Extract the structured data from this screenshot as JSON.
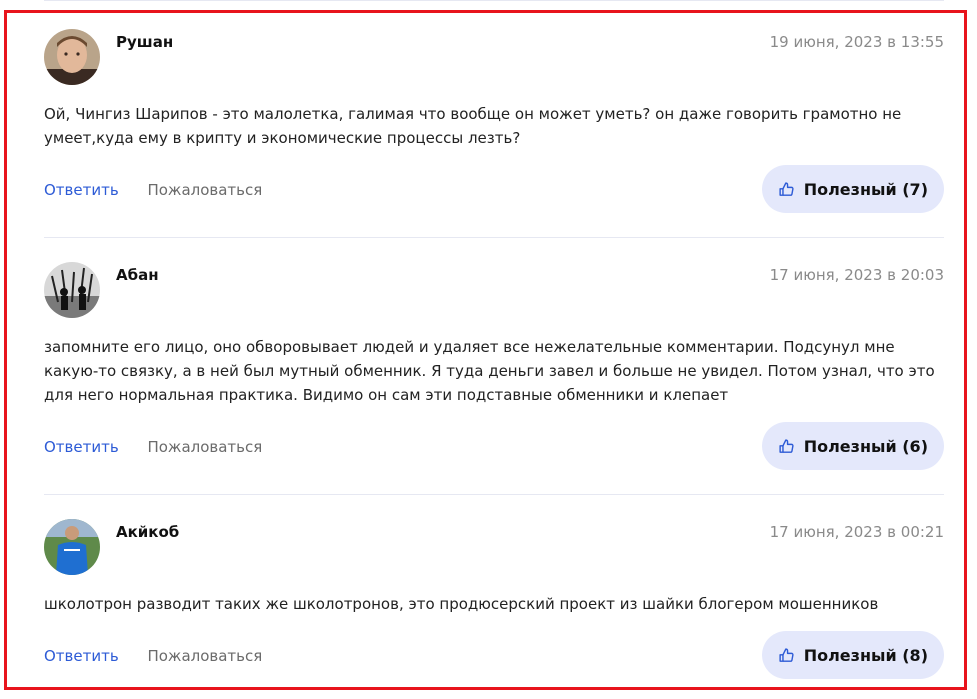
{
  "comments": [
    {
      "author": "Рушан",
      "date": "19 июня, 2023 в 13:55",
      "text": "Ой, Чингиз Шарипов - это малолетка, галимая что вообще он может уметь? он даже говорить грамотно не умеет,куда ему в крипту и экономические процессы лезть?",
      "reply": "Ответить",
      "report": "Пожаловаться",
      "useful": "Полезный (7)",
      "avatar_icon": "avatar-photo-young-man"
    },
    {
      "author": "Абан",
      "date": "17 июня, 2023 в 20:03",
      "text": "запомните его лицо, оно обворовывает людей и удаляет все нежелательные комментарии. Подсунул мне какую-то связку, а в ней был мутный обменник. Я туда деньги завел и больше не увидел. Потом узнал, что это для него нормальная практика. Видимо он сам эти подставные обменники и клепает",
      "reply": "Ответить",
      "report": "Пожаловаться",
      "useful": "Полезный (6)",
      "avatar_icon": "avatar-photo-bw-group"
    },
    {
      "author": "Акйкоб",
      "date": "17 июня, 2023 в 00:21",
      "text": "школотрон разводит таких же школотронов, это продюсерский проект из шайки блогером мошенников",
      "reply": "Ответить",
      "report": "Пожаловаться",
      "useful": "Полезный (8)",
      "avatar_icon": "avatar-photo-blue-shirt"
    }
  ],
  "colors": {
    "frame": "#e8141c",
    "link": "#2d5bd6",
    "useful_bg": "#e4e8fb",
    "muted": "#8a8a8a"
  },
  "icons": {
    "useful": "thumbs-up-icon"
  }
}
